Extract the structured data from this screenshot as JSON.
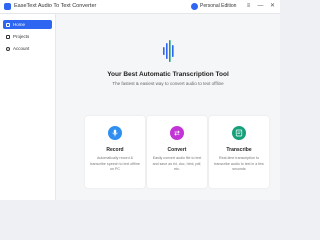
{
  "app": {
    "title": "EaseText Audio To Text Converter",
    "edition": "Personal Edition",
    "accent_color": "#2e66f2",
    "window_buttons": [
      "≡",
      "—",
      "✕"
    ]
  },
  "sidebar": {
    "items": [
      {
        "label": "Home",
        "icon": "home-icon",
        "active": true
      },
      {
        "label": "Projects",
        "icon": "folder-icon",
        "active": false
      },
      {
        "label": "Account",
        "icon": "user-icon",
        "active": false
      }
    ]
  },
  "hero": {
    "title": "Your Best Automatic Transcription Tool",
    "subtitle": "The fastest & easiest way to convert audio to text offline"
  },
  "cards": [
    {
      "title": "Record",
      "description": "Automatically record & transcribe speech to text offline on PC",
      "icon": "microphone-icon",
      "color": "#2e8ff0"
    },
    {
      "title": "Convert",
      "description": "Easily convert audio file to text and save as txt, doc, html, pdf, etc.",
      "icon": "convert-icon",
      "color": "#c234d6"
    },
    {
      "title": "Transcribe",
      "description": "Real-time transcription to transcribe audio to text in a few seconds",
      "icon": "transcribe-icon",
      "color": "#16a07a"
    }
  ]
}
